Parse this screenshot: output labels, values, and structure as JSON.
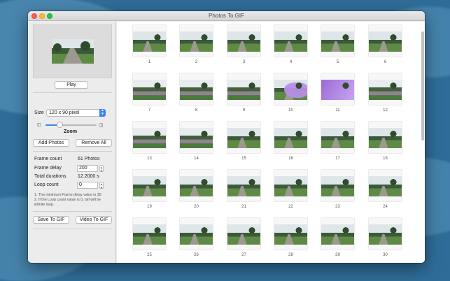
{
  "window": {
    "title": "Photos To GIF"
  },
  "left": {
    "play_label": "Play",
    "size_label": "Size",
    "size_value": "120 x 90 pixel",
    "zoom_label": "Zoom",
    "zoom_level": 0.28,
    "add_photos_label": "Add Photos",
    "remove_all_label": "Remove All",
    "frame_count_label": "Frame count",
    "frame_count_value": "61 Photos",
    "frame_delay_label": "Frame delay",
    "frame_delay_value": "200",
    "total_durations_label": "Total durations",
    "total_durations_value": "12.2000 s",
    "loop_count_label": "Loop count",
    "loop_count_value": "0",
    "note_line1": "1. The minimum Frame delay value is 30",
    "note_line2": "2. If the Loop count value is 0, Gif will be infinite loop.",
    "save_to_gif_label": "Save To GIF",
    "video_to_gif_label": "Video To GIF"
  },
  "grid": {
    "frames": [
      "1",
      "2",
      "3",
      "4",
      "5",
      "6",
      "7",
      "8",
      "9",
      "10",
      "11",
      "12",
      "13",
      "14",
      "15",
      "16",
      "17",
      "18",
      "19",
      "20",
      "21",
      "22",
      "23",
      "24",
      "25",
      "26",
      "27",
      "28",
      "29",
      "30"
    ]
  }
}
